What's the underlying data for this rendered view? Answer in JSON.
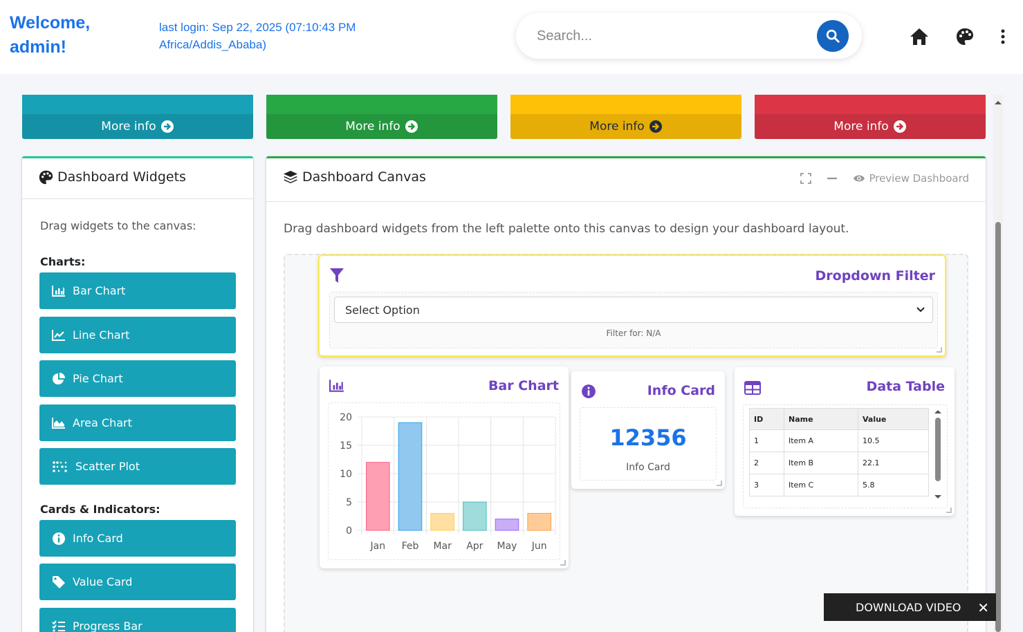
{
  "header": {
    "welcome": "Welcome, admin!",
    "last_login": "last login: Sep 22, 2025 (07:10:43 PM Africa/Addis_Ababa)",
    "search_placeholder": "Search...",
    "icons": [
      "search-icon",
      "home-icon",
      "palette-icon",
      "more-vert-icon"
    ]
  },
  "small_boxes": [
    {
      "label": "More info",
      "color": "#17a2b8"
    },
    {
      "label": "More info",
      "color": "#28a745"
    },
    {
      "label": "More info",
      "color": "#ffc107"
    },
    {
      "label": "More info",
      "color": "#dc3545"
    }
  ],
  "widgets_panel": {
    "title": "Dashboard Widgets",
    "instruction": "Drag widgets to the canvas:",
    "charts_label": "Charts:",
    "charts": [
      "Bar Chart",
      "Line Chart",
      "Pie Chart",
      "Area Chart",
      "Scatter Plot"
    ],
    "cards_label": "Cards & Indicators:",
    "cards": [
      "Info Card",
      "Value Card",
      "Progress Bar"
    ]
  },
  "canvas": {
    "title": "Dashboard Canvas",
    "preview_label": "Preview Dashboard",
    "description": "Drag dashboard widgets from the left palette onto this canvas to design your dashboard layout.",
    "filter": {
      "title": "Dropdown Filter",
      "select_value": "Select Option",
      "filter_for": "Filter for: N/A"
    },
    "bar_widget": {
      "title": "Bar Chart"
    },
    "info_widget": {
      "title": "Info Card",
      "value": "12356",
      "label": "Info Card"
    },
    "table_widget": {
      "title": "Data Table",
      "columns": [
        "ID",
        "Name",
        "Value"
      ],
      "rows": [
        [
          "1",
          "Item A",
          "10.5"
        ],
        [
          "2",
          "Item B",
          "22.1"
        ],
        [
          "3",
          "Item C",
          "5.8"
        ]
      ]
    }
  },
  "chart_data": {
    "type": "bar",
    "categories": [
      "Jan",
      "Feb",
      "Mar",
      "Apr",
      "May",
      "Jun"
    ],
    "values": [
      12,
      19,
      3,
      5,
      2,
      3
    ],
    "colors": [
      "#ff9fb3",
      "#90c8f0",
      "#ffe0a0",
      "#9fdcdc",
      "#c9aef5",
      "#ffcc99"
    ],
    "border_colors": [
      "#ff6384",
      "#36a2eb",
      "#ffce56",
      "#4bc0c0",
      "#9966ff",
      "#ff9f40"
    ],
    "yticks": [
      0,
      5,
      10,
      15,
      20
    ],
    "ylim": [
      0,
      20
    ],
    "grid": true
  },
  "download_bar": {
    "label": "DOWNLOAD VIDEO"
  }
}
